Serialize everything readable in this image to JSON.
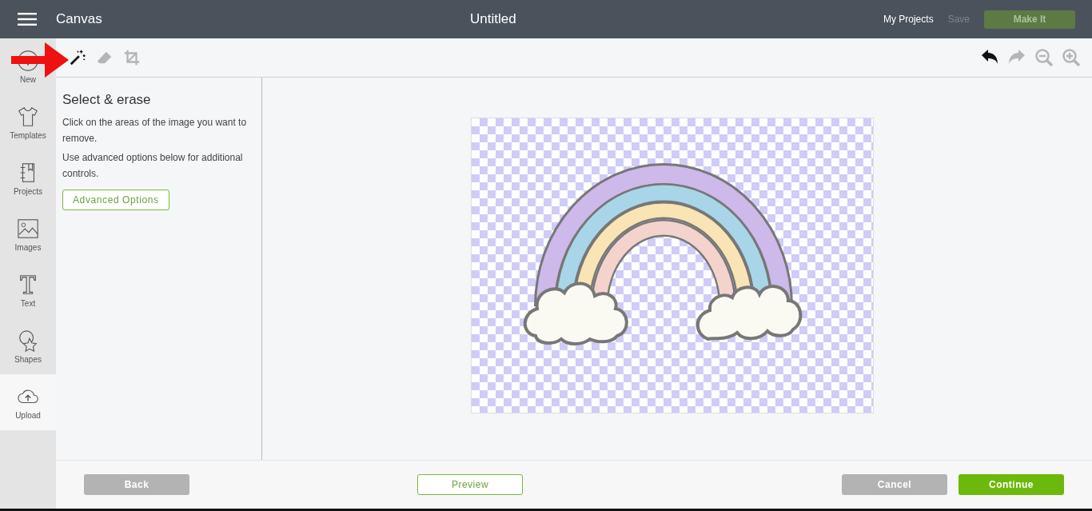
{
  "header": {
    "title": "Canvas",
    "document_title": "Untitled",
    "links": [
      {
        "label": "My Projects",
        "disabled": false
      },
      {
        "label": "Save",
        "disabled": true
      }
    ],
    "make_it": {
      "label": "Make It",
      "disabled": true
    }
  },
  "sidebar": {
    "items": [
      {
        "kind": "new",
        "label": "New",
        "selected": false
      },
      {
        "kind": "templates",
        "label": "Templates",
        "selected": false
      },
      {
        "kind": "projects",
        "label": "Projects",
        "selected": false
      },
      {
        "kind": "images",
        "label": "Images",
        "selected": false
      },
      {
        "kind": "text",
        "label": "Text",
        "selected": false
      },
      {
        "kind": "shapes",
        "label": "Shapes",
        "selected": false
      },
      {
        "kind": "upload",
        "label": "Upload",
        "selected": true
      }
    ]
  },
  "toolbar": {
    "tools": [
      {
        "kind": "wand",
        "selected": true
      },
      {
        "kind": "eraser",
        "selected": false
      },
      {
        "kind": "crop",
        "selected": false
      }
    ],
    "actions": [
      {
        "kind": "undo",
        "disabled": false
      },
      {
        "kind": "redo",
        "disabled": true
      },
      {
        "kind": "zoom_out",
        "disabled": true
      },
      {
        "kind": "zoom_in",
        "disabled": true
      }
    ]
  },
  "panel": {
    "title": "Select & erase",
    "paragraphs": [
      "Click on the areas of the image you want to remove.",
      "Use advanced options below for additional controls."
    ],
    "button": "Advanced Options"
  },
  "footer": {
    "back": "Back",
    "preview": "Preview",
    "cancel": "Cancel",
    "continue": "Continue"
  }
}
